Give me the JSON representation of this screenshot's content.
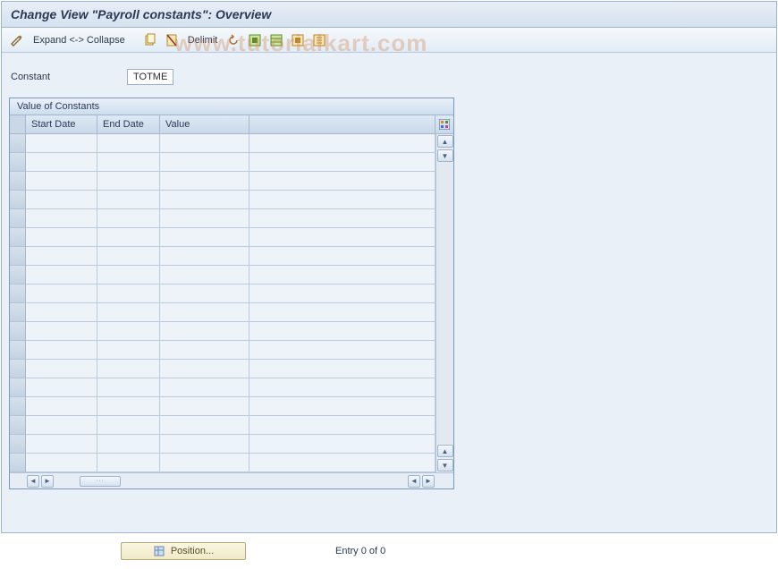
{
  "window": {
    "title": "Change View \"Payroll constants\": Overview"
  },
  "toolbar": {
    "expand_label": "Expand <-> Collapse",
    "delimit_label": "Delimit"
  },
  "fields": {
    "constant_label": "Constant",
    "constant_value": "TOTME"
  },
  "table": {
    "title": "Value of Constants",
    "columns": {
      "start_date": "Start Date",
      "end_date": "End Date",
      "value": "Value"
    },
    "rows": []
  },
  "footer": {
    "position_btn": "Position...",
    "entry_text": "Entry 0 of 0"
  },
  "watermark": "www.tutorialkart.com"
}
